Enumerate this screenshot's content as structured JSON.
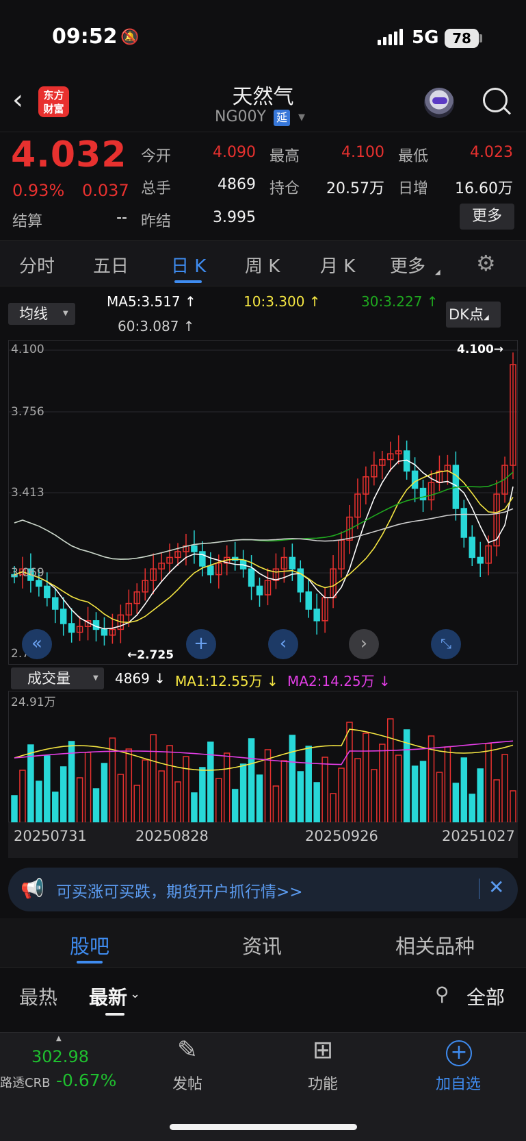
{
  "status_bar": {
    "time": "09:52",
    "network": "5G",
    "battery": "78"
  },
  "header": {
    "title": "天然气",
    "symbol": "NG00Y",
    "delay_badge": "延",
    "logo_line1": "东方",
    "logo_line2": "财富"
  },
  "quote": {
    "price": "4.032",
    "change_pct": "0.93%",
    "change": "0.037",
    "open_label": "今开",
    "open": "4.090",
    "high_label": "最高",
    "high": "4.100",
    "low_label": "最低",
    "low": "4.023",
    "volume_label": "总手",
    "volume": "4869",
    "oi_label": "持仓",
    "oi": "20.57万",
    "daily_inc_label": "日增",
    "daily_inc": "16.60万",
    "settle_label": "结算",
    "settle": "--",
    "prev_settle_label": "昨结",
    "prev_settle": "3.995",
    "more_button": "更多"
  },
  "period_tabs": [
    "分时",
    "五日",
    "日 K",
    "周 K",
    "月 K",
    "更多"
  ],
  "ma_row": {
    "selector": "均线",
    "ma5": "MA5:3.517 ↑",
    "ma10": "10:3.300 ↑",
    "ma30": "30:3.227 ↑",
    "ma60": "60:3.087 ↑",
    "dk": "DK点"
  },
  "kchart": {
    "y_labels": [
      "4.100",
      "3.756",
      "3.413",
      "3.069",
      "2.725"
    ],
    "high_marker": "4.100→",
    "low_marker": "←2.725"
  },
  "volume": {
    "selector": "成交量",
    "value": "4869 ↓",
    "ma1": "MA1:12.55万 ↓",
    "ma2": "MA2:14.25万 ↓",
    "y_max": "24.91万"
  },
  "dates": [
    "20250731",
    "20250828",
    "20250926",
    "20251027"
  ],
  "banner": {
    "text": "可买涨可买跌，期货开户抓行情>>"
  },
  "community_tabs": [
    "股吧",
    "资讯",
    "相关品种"
  ],
  "sort": {
    "hot": "最热",
    "latest": "最新",
    "filter": "全部"
  },
  "bottom_bar": {
    "crb_value": "302.98",
    "crb_name": "路透CRB",
    "crb_pct": "-0.67%",
    "post": "发帖",
    "functions": "功能",
    "add_watch": "加自选"
  },
  "colors": {
    "up": "#e8312f",
    "down": "#28d8d8",
    "accent": "#3f8cf0",
    "ma5": "#ffffff",
    "ma10": "#f5e642",
    "ma30": "#1fa81f",
    "ma60": "#cfcfcf",
    "vol_ma2": "#e33ee6"
  }
}
